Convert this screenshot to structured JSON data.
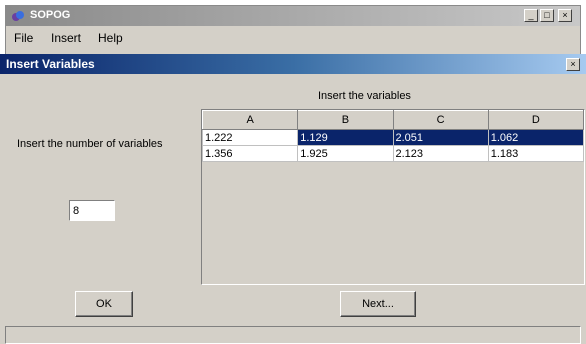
{
  "app": {
    "title": "SOPOG",
    "window_controls": {
      "minimize": "_",
      "maximize": "□",
      "close": "×"
    },
    "menu": [
      "File",
      "Insert",
      "Help"
    ]
  },
  "dialog": {
    "title": "Insert Variables",
    "close": "×",
    "count_label": "Insert  the number of variables",
    "count_value": "8",
    "table_title": "Insert  the variables",
    "columns": [
      "A",
      "B",
      "C",
      "D"
    ],
    "rows": [
      [
        "1.222",
        "1.129",
        "2.051",
        "1.062"
      ],
      [
        "1.356",
        "1.925",
        "2.123",
        "1.183"
      ]
    ],
    "selected_row": 0,
    "ok_label": "OK",
    "next_label": "Next..."
  },
  "colors": {
    "selection": "#0a246a",
    "dialog_title_bar": "#0a246a"
  }
}
